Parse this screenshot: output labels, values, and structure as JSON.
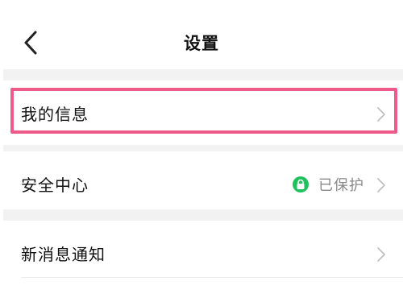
{
  "header": {
    "title": "设置",
    "back_icon": "chevron-left-icon"
  },
  "settings": {
    "items": [
      {
        "label": "我的信息",
        "icon": "chevron-right-icon"
      },
      {
        "label": "安全中心",
        "status_text": "已保护",
        "status_icon": "lock-icon",
        "icon": "chevron-right-icon"
      },
      {
        "label": "新消息通知",
        "icon": "chevron-right-icon"
      }
    ]
  },
  "colors": {
    "highlight": "#ee5a8a",
    "secure_badge": "#20c05c",
    "section_gap": "#f2f2f2",
    "chevron": "#c0c0c0"
  }
}
